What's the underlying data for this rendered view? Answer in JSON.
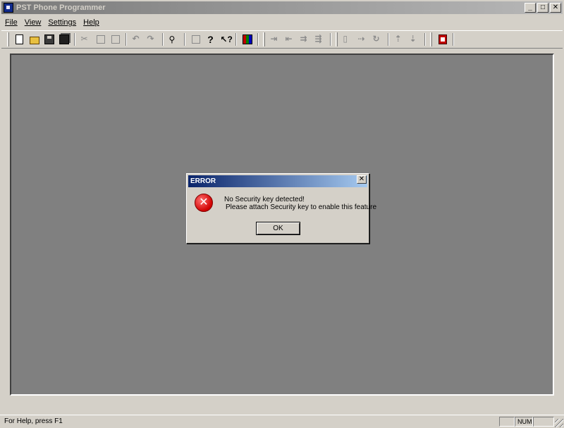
{
  "window": {
    "title": "PST Phone Programmer"
  },
  "title_buttons": {
    "minimize": "_",
    "maximize": "□",
    "close": "✕"
  },
  "menu": [
    {
      "label": "File"
    },
    {
      "label": "View"
    },
    {
      "label": "Settings"
    },
    {
      "label": "Help"
    }
  ],
  "toolbar": {
    "icons": [
      "new-file-icon",
      "open-folder-icon",
      "save-icon",
      "save-all-icon",
      "cut-icon",
      "copy-icon",
      "paste-icon",
      "undo-icon",
      "redo-icon",
      "find-icon",
      "print-icon",
      "help-icon",
      "whats-this-icon",
      "program-icon",
      "send-icon",
      "receive-icon",
      "read-icon",
      "write-icon",
      "clone-icon",
      "import-icon",
      "refresh-icon",
      "upload-icon",
      "download-icon",
      "report-icon"
    ]
  },
  "dialog": {
    "title": "ERROR",
    "close_glyph": "✕",
    "icon_glyph": "✕",
    "line1": "No Security key detected!",
    "line2": "Please attach Security key to enable this feature",
    "ok_label": "OK"
  },
  "statusbar": {
    "help_text": "For Help, press F1",
    "num_indicator": "NUM"
  }
}
